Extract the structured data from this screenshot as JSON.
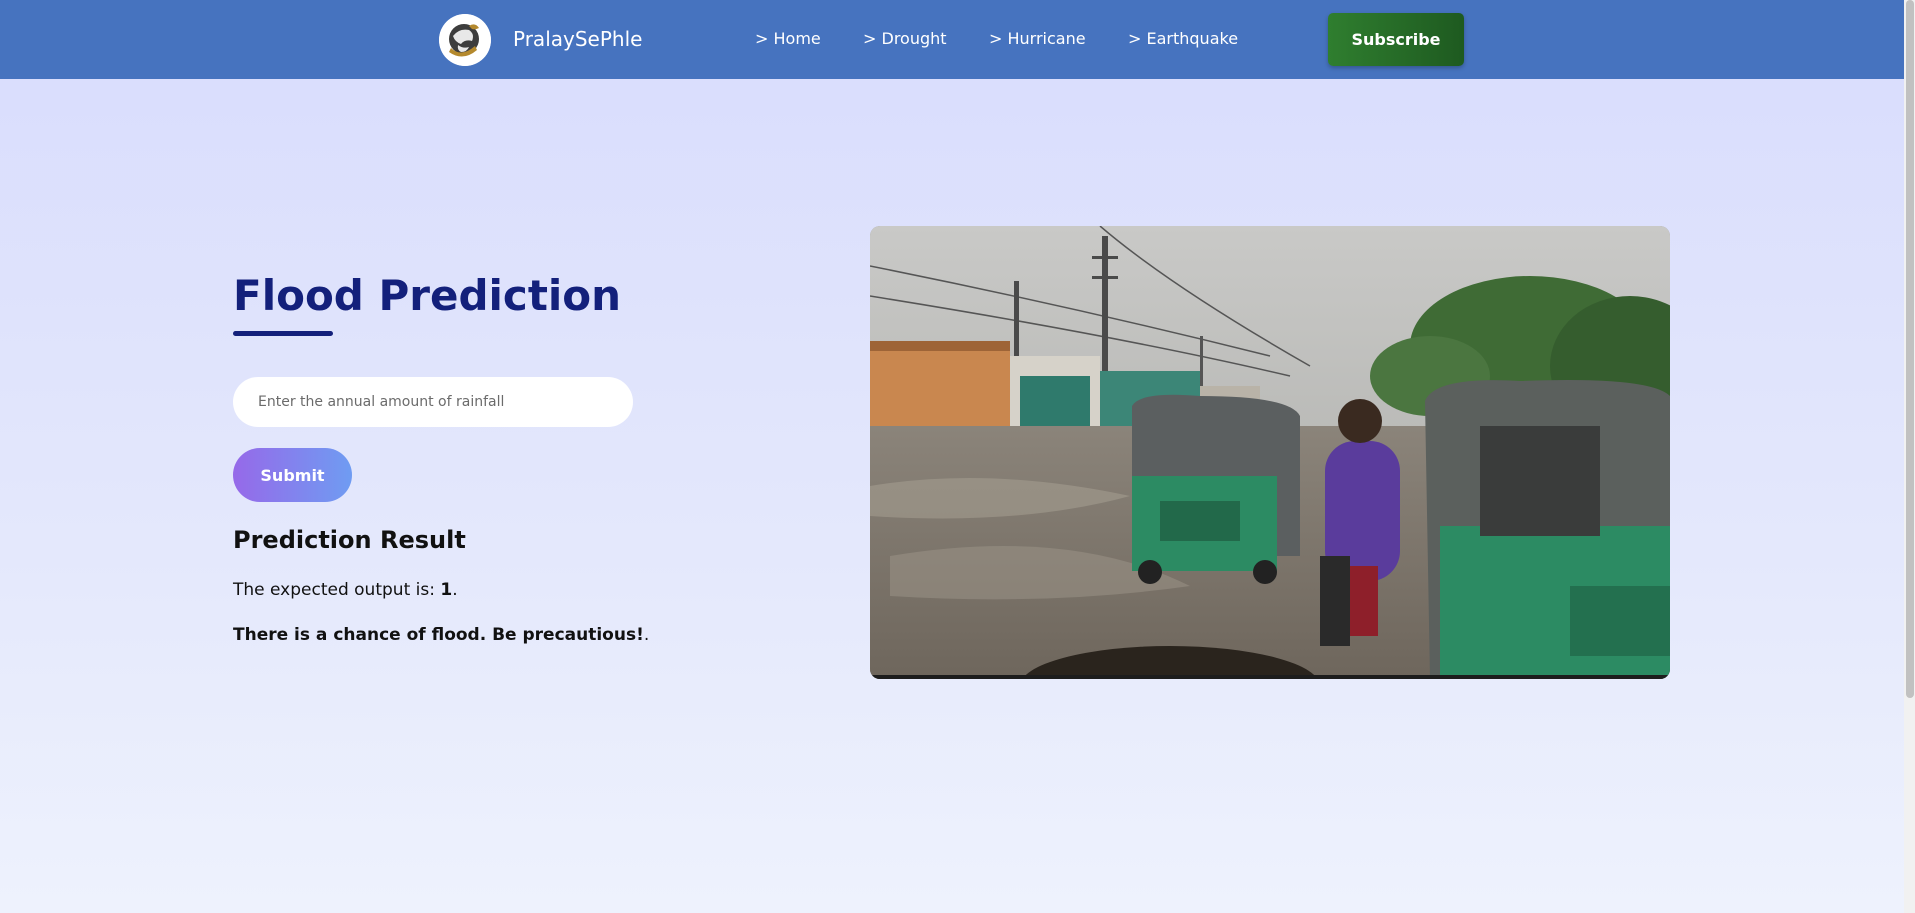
{
  "header": {
    "brand": "PralaySePhle",
    "nav": [
      {
        "label": "> Home"
      },
      {
        "label": "> Drought"
      },
      {
        "label": "> Hurricane"
      },
      {
        "label": "> Earthquake"
      }
    ],
    "subscribe_label": "Subscribe",
    "logo_icon": "globe-logo-icon",
    "bg_color": "#4673bf",
    "subscribe_color": "#2f7e2f"
  },
  "main": {
    "title": "Flood Prediction",
    "title_color": "#13207b",
    "rainfall_input": {
      "placeholder": "Enter the annual amount of rainfall",
      "value": ""
    },
    "submit_label": "Submit",
    "result_heading": "Prediction Result",
    "result_output_prefix": "The expected output is: ",
    "result_output_value": "1",
    "result_output_suffix": ".",
    "result_message": "There is a chance of flood. Be precautious!",
    "result_message_suffix": "."
  },
  "image": {
    "subject": "flooded-street-photo"
  }
}
